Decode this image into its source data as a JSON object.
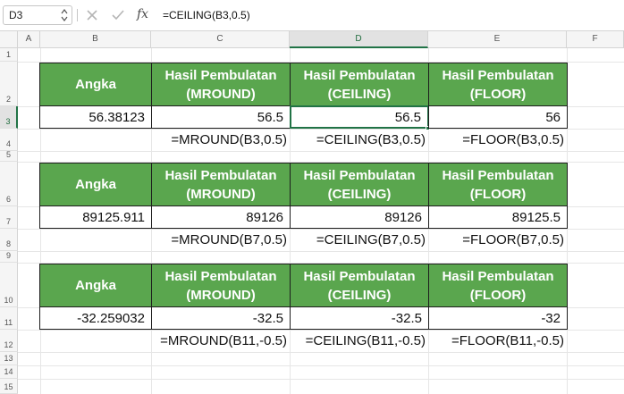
{
  "formula_bar": {
    "name_box": "D3",
    "fx_label": "fx",
    "formula": "=CEILING(B3,0.5)"
  },
  "columns": [
    "A",
    "B",
    "C",
    "D",
    "E",
    "F"
  ],
  "rows": [
    "1",
    "2",
    "3",
    "4",
    "5",
    "6",
    "7",
    "8",
    "9",
    "10",
    "11",
    "12",
    "13",
    "14",
    "15"
  ],
  "selection": {
    "cell": "D3",
    "column": "D",
    "row": "3"
  },
  "theme": {
    "header_fill": "#5aa64e",
    "selection": "#217346"
  },
  "tables": [
    {
      "headers": [
        "Angka",
        "Hasil Pembulatan\n(MROUND)",
        "Hasil Pembulatan\n(CEILING)",
        "Hasil Pembulatan\n(FLOOR)"
      ],
      "values": [
        "56.38123",
        "56.5",
        "56.5",
        "56"
      ],
      "formulas": [
        "=MROUND(B3,0.5)",
        "=CEILING(B3,0.5)",
        "=FLOOR(B3,0.5)"
      ]
    },
    {
      "headers": [
        "Angka",
        "Hasil Pembulatan\n(MROUND)",
        "Hasil Pembulatan\n(CEILING)",
        "Hasil Pembulatan\n(FLOOR)"
      ],
      "values": [
        "89125.911",
        "89126",
        "89126",
        "89125.5"
      ],
      "formulas": [
        "=MROUND(B7,0.5)",
        "=CEILING(B7,0.5)",
        "=FLOOR(B7,0.5)"
      ]
    },
    {
      "headers": [
        "Angka",
        "Hasil Pembulatan\n(MROUND)",
        "Hasil Pembulatan\n(CEILING)",
        "Hasil Pembulatan\n(FLOOR)"
      ],
      "values": [
        "-32.259032",
        "-32.5",
        "-32.5",
        "-32"
      ],
      "formulas": [
        "=MROUND(B11,-0.5)",
        "=CEILING(B11,-0.5)",
        "=FLOOR(B11,-0.5)"
      ]
    }
  ]
}
